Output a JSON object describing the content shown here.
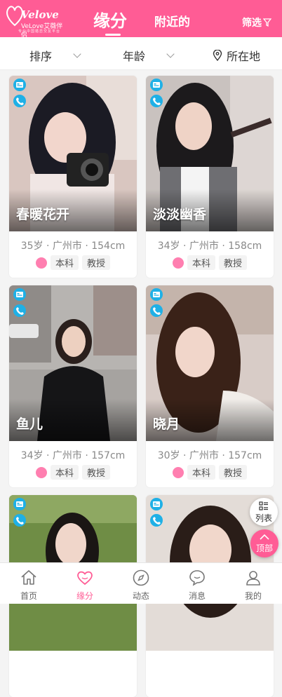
{
  "header": {
    "logo_text": "Velove",
    "logo_cn": "VeLove艾薇伴侣",
    "logo_sub": "专业中国婚恋交友平台",
    "tab_active": "缘分",
    "tab_nearby": "附近的",
    "filter_label": "筛选"
  },
  "sortbar": {
    "sort_label": "排序",
    "age_label": "年龄",
    "location_label": "所在地"
  },
  "cards": [
    {
      "name": "春暖花开",
      "info": "35岁 · 广州市 · 154cm",
      "tags": [
        "本科",
        "教授"
      ]
    },
    {
      "name": "淡淡幽香",
      "info": "34岁 · 广州市 · 158cm",
      "tags": [
        "本科",
        "教授"
      ]
    },
    {
      "name": "鱼儿",
      "info": "34岁 · 广州市 · 157cm",
      "tags": [
        "本科",
        "教授"
      ]
    },
    {
      "name": "晓月",
      "info": "30岁 · 广州市 · 157cm",
      "tags": [
        "本科",
        "教授"
      ]
    },
    {
      "name": "",
      "info": "",
      "tags": []
    },
    {
      "name": "",
      "info": "",
      "tags": []
    }
  ],
  "float": {
    "list_label": "列表",
    "top_label": "顶部"
  },
  "nav": [
    {
      "label": "首页",
      "icon": "home-icon"
    },
    {
      "label": "缘分",
      "icon": "heart-icon"
    },
    {
      "label": "动态",
      "icon": "compass-icon"
    },
    {
      "label": "消息",
      "icon": "message-icon"
    },
    {
      "label": "我的",
      "icon": "user-icon"
    }
  ],
  "colors": {
    "brand": "#ff5c95",
    "badge": "#1fb0e6"
  }
}
